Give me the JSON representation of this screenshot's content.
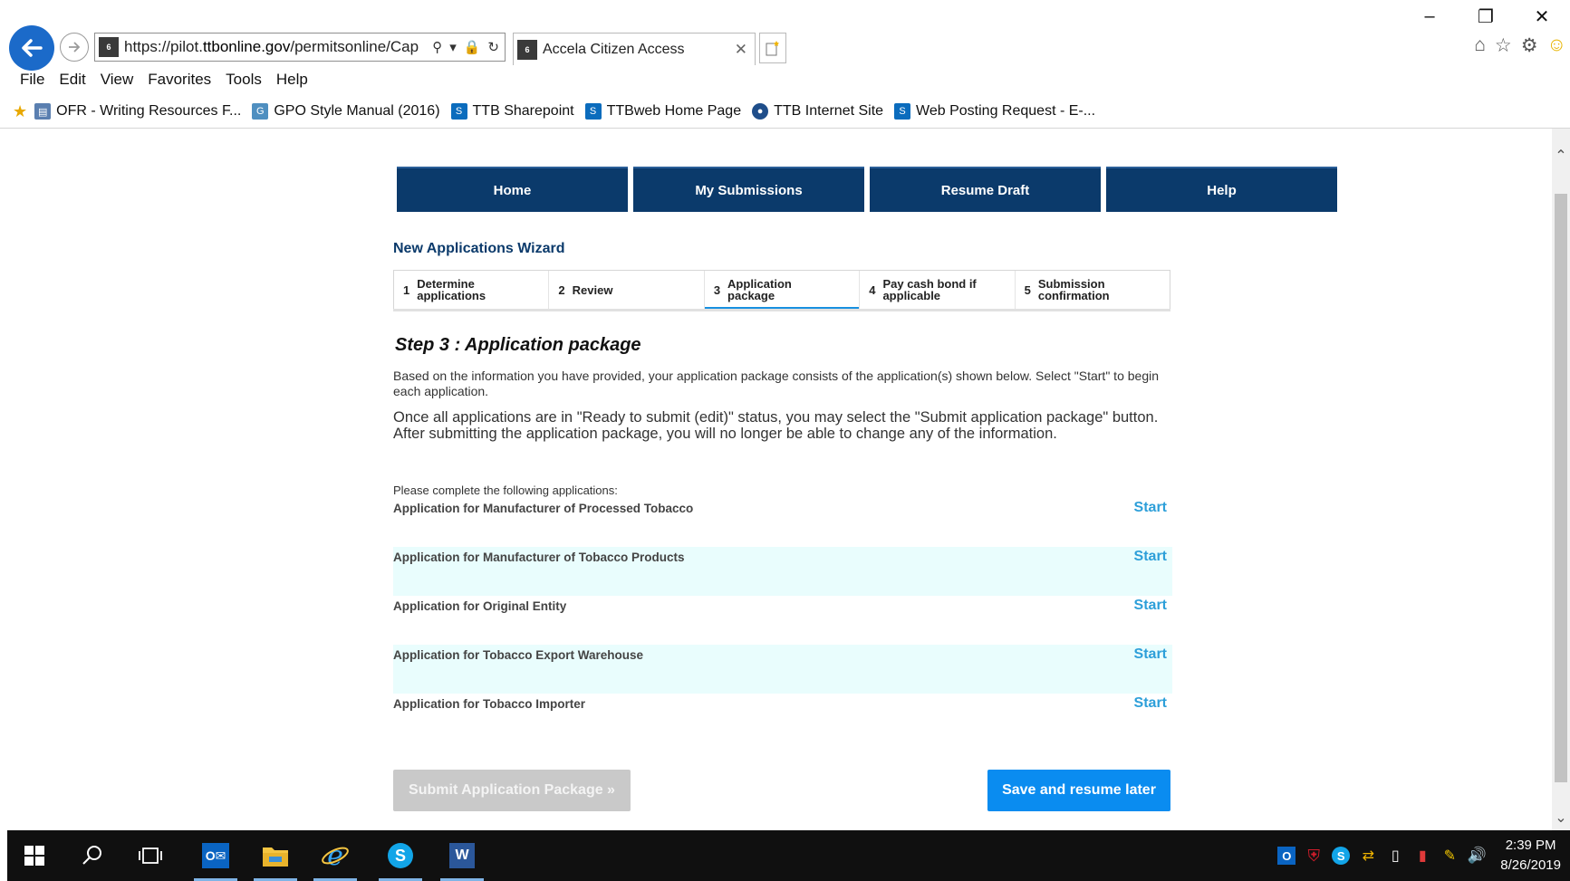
{
  "browser": {
    "url_prefix": "https://pilot.",
    "url_domain": "ttbonline.gov",
    "url_rest": "/permitsonline/Cap",
    "tab_title": "Accela Citizen Access",
    "tab_favicon_text": "EAP 6",
    "menu": [
      "File",
      "Edit",
      "View",
      "Favorites",
      "Tools",
      "Help"
    ],
    "favorites": [
      {
        "label": "OFR - Writing Resources F...",
        "icon": "page-icon",
        "color": "#5a7fb0"
      },
      {
        "label": "GPO Style Manual (2016)",
        "icon": "gpo-icon",
        "color": "#4f8fc0"
      },
      {
        "label": "TTB Sharepoint",
        "icon": "sharepoint-icon",
        "color": "#0b6cbd"
      },
      {
        "label": "TTBweb Home Page",
        "icon": "sharepoint-icon",
        "color": "#0b6cbd"
      },
      {
        "label": "TTB Internet Site",
        "icon": "seal-icon",
        "color": "#1f4e8a"
      },
      {
        "label": "Web Posting Request - E-...",
        "icon": "sharepoint-icon",
        "color": "#0b6cbd"
      }
    ]
  },
  "nav": {
    "home": "Home",
    "submissions": "My Submissions",
    "resume": "Resume Draft",
    "help": "Help"
  },
  "wizard": {
    "title": "New Applications Wizard",
    "steps": [
      {
        "num": "1",
        "line1": "Determine",
        "line2": "applications"
      },
      {
        "num": "2",
        "line1": "Review",
        "line2": ""
      },
      {
        "num": "3",
        "line1": "Application",
        "line2": "package"
      },
      {
        "num": "4",
        "line1": "Pay cash bond if",
        "line2": "applicable"
      },
      {
        "num": "5",
        "line1": "Submission",
        "line2": "confirmation"
      }
    ],
    "active_step": 3
  },
  "content": {
    "heading": "Step 3 : Application package",
    "intro1": "Based on the information you have provided, your application package consists of the application(s) shown below. Select \"Start\" to begin each application.",
    "intro2": "Once all applications are in \"Ready to submit (edit)\" status, you may select the \"Submit application package\" button.  After submitting the application package, you will no longer be able to change any of the information.",
    "apps_label": "Please complete the following applications:",
    "applications": [
      {
        "name": "Application for Manufacturer of Processed Tobacco",
        "action": "Start"
      },
      {
        "name": "Application for Manufacturer of Tobacco Products",
        "action": "Start"
      },
      {
        "name": "Application for Original Entity",
        "action": "Start"
      },
      {
        "name": "Application for Tobacco Export Warehouse",
        "action": "Start"
      },
      {
        "name": "Application for Tobacco Importer",
        "action": "Start"
      }
    ],
    "submit_label": "Submit Application Package »",
    "save_label": "Save and resume later"
  },
  "taskbar": {
    "time": "2:39 PM",
    "date": "8/26/2019"
  }
}
